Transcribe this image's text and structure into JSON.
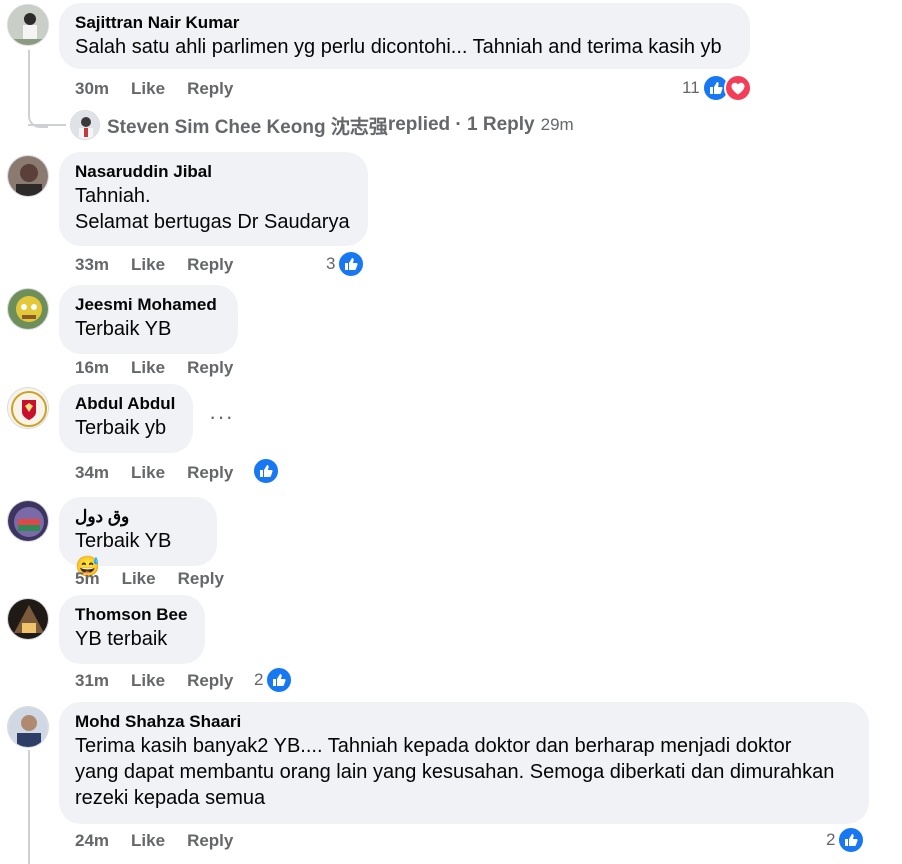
{
  "comments": [
    {
      "author": "Sajittran Nair Kumar",
      "text": "Salah satu ahli parlimen yg perlu dicontohi... Tahniah and terima kasih yb",
      "time": "30m",
      "like": "Like",
      "reply": "Reply",
      "reactions": "11",
      "reaction_icons": [
        "like-icon",
        "love-icon"
      ],
      "avatar_color": "#9aa59a"
    },
    {
      "author": "Nasaruddin Jibal",
      "text_lines": [
        "Tahniah.",
        "Selamat bertugas Dr Saudarya"
      ],
      "time": "33m",
      "like": "Like",
      "reply": "Reply",
      "reactions": "3",
      "reaction_icons": [
        "like-icon"
      ],
      "avatar_color": "#6b5a52"
    },
    {
      "author": "Jeesmi Mohamed",
      "text": "Terbaik YB",
      "time": "16m",
      "like": "Like",
      "reply": "Reply",
      "avatar_color": "#d7c13a"
    },
    {
      "author": "Abdul Abdul",
      "text": "Terbaik yb",
      "time": "34m",
      "like": "Like",
      "reply": "Reply",
      "reactions": "",
      "reaction_icons": [
        "like-icon"
      ],
      "more_options": "···",
      "avatar_color": "#c8102e"
    },
    {
      "author": "وق دول",
      "text": "Terbaik YB",
      "emoji": "😅",
      "time": "5m",
      "like": "Like",
      "reply": "Reply",
      "avatar_color": "#6a5a8c"
    },
    {
      "author": "Thomson Bee",
      "text": "YB terbaik",
      "time": "31m",
      "like": "Like",
      "reply": "Reply",
      "reactions": "2",
      "reaction_icons": [
        "like-icon"
      ],
      "avatar_color": "#3b2f28"
    },
    {
      "author": "Mohd Shahza Shaari",
      "text_lines": [
        "Terima kasih banyak2 YB.... Tahniah kepada doktor dan berharap menjadi doktor",
        "yang dapat membantu orang lain yang kesusahan. Semoga diberkati dan dimurahkan",
        "rezeki kepada semua"
      ],
      "time": "24m",
      "like": "Like",
      "reply": "Reply",
      "reactions": "2",
      "reaction_icons": [
        "like-icon"
      ],
      "avatar_color": "#4a5d78"
    }
  ],
  "reply_summary": {
    "author": "Steven Sim Chee Keong 沈志强",
    "text": " replied · 1 Reply",
    "time": "29m"
  },
  "colors": {
    "like_blue": "#1877f2",
    "love_red": "#f33e58",
    "bubble_bg": "#f0f2f5",
    "meta_gray": "#65676b"
  }
}
